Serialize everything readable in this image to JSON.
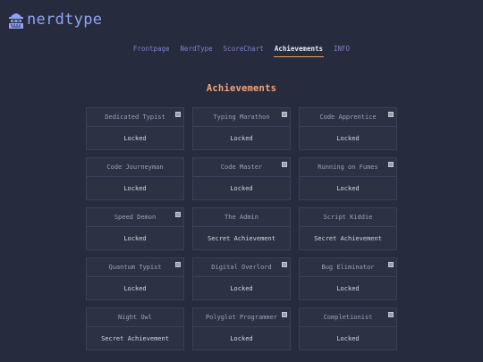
{
  "app": {
    "logo_text": "nerdtype"
  },
  "nav": {
    "items": [
      {
        "label": "Frontpage"
      },
      {
        "label": "NerdType"
      },
      {
        "label": "ScoreChart"
      },
      {
        "label": "Achievements",
        "active": true
      },
      {
        "label": "INFO"
      }
    ]
  },
  "page": {
    "title": "Achievements"
  },
  "achievements": [
    {
      "name": "Dedicated Typist",
      "status": "Locked",
      "badge": true
    },
    {
      "name": "Typing Marathon",
      "status": "Locked",
      "badge": true
    },
    {
      "name": "Code Apprentice",
      "status": "Locked",
      "badge": true
    },
    {
      "name": "Code Journeyman",
      "status": "Locked",
      "badge": false
    },
    {
      "name": "Code Master",
      "status": "Locked",
      "badge": true
    },
    {
      "name": "Running on Fumes",
      "status": "Locked",
      "badge": true
    },
    {
      "name": "Speed Demon",
      "status": "Locked",
      "badge": true
    },
    {
      "name": "The Admin",
      "status": "Secret Achievement",
      "badge": false
    },
    {
      "name": "Script Kiddie",
      "status": "Secret Achievement",
      "badge": false
    },
    {
      "name": "Quantum Typist",
      "status": "Locked",
      "badge": true
    },
    {
      "name": "Digital Overlord",
      "status": "Locked",
      "badge": true
    },
    {
      "name": "Bug Eliminator",
      "status": "Locked",
      "badge": true
    },
    {
      "name": "Night Owl",
      "status": "Secret Achievement",
      "badge": false
    },
    {
      "name": "Polyglot Programmer",
      "status": "Locked",
      "badge": true
    },
    {
      "name": "Completionist",
      "status": "Locked",
      "badge": true
    }
  ],
  "colors": {
    "background": "#272b3e",
    "logo": "#8fa4f0",
    "nav_link": "#7b84c4",
    "nav_active_underline": "#e0a25e",
    "title": "#f0a57a",
    "card_background": "#2d3144",
    "card_border": "#3c4058"
  },
  "icons": {
    "logo": "hacker-icon",
    "badge": "lock-badge-icon"
  }
}
